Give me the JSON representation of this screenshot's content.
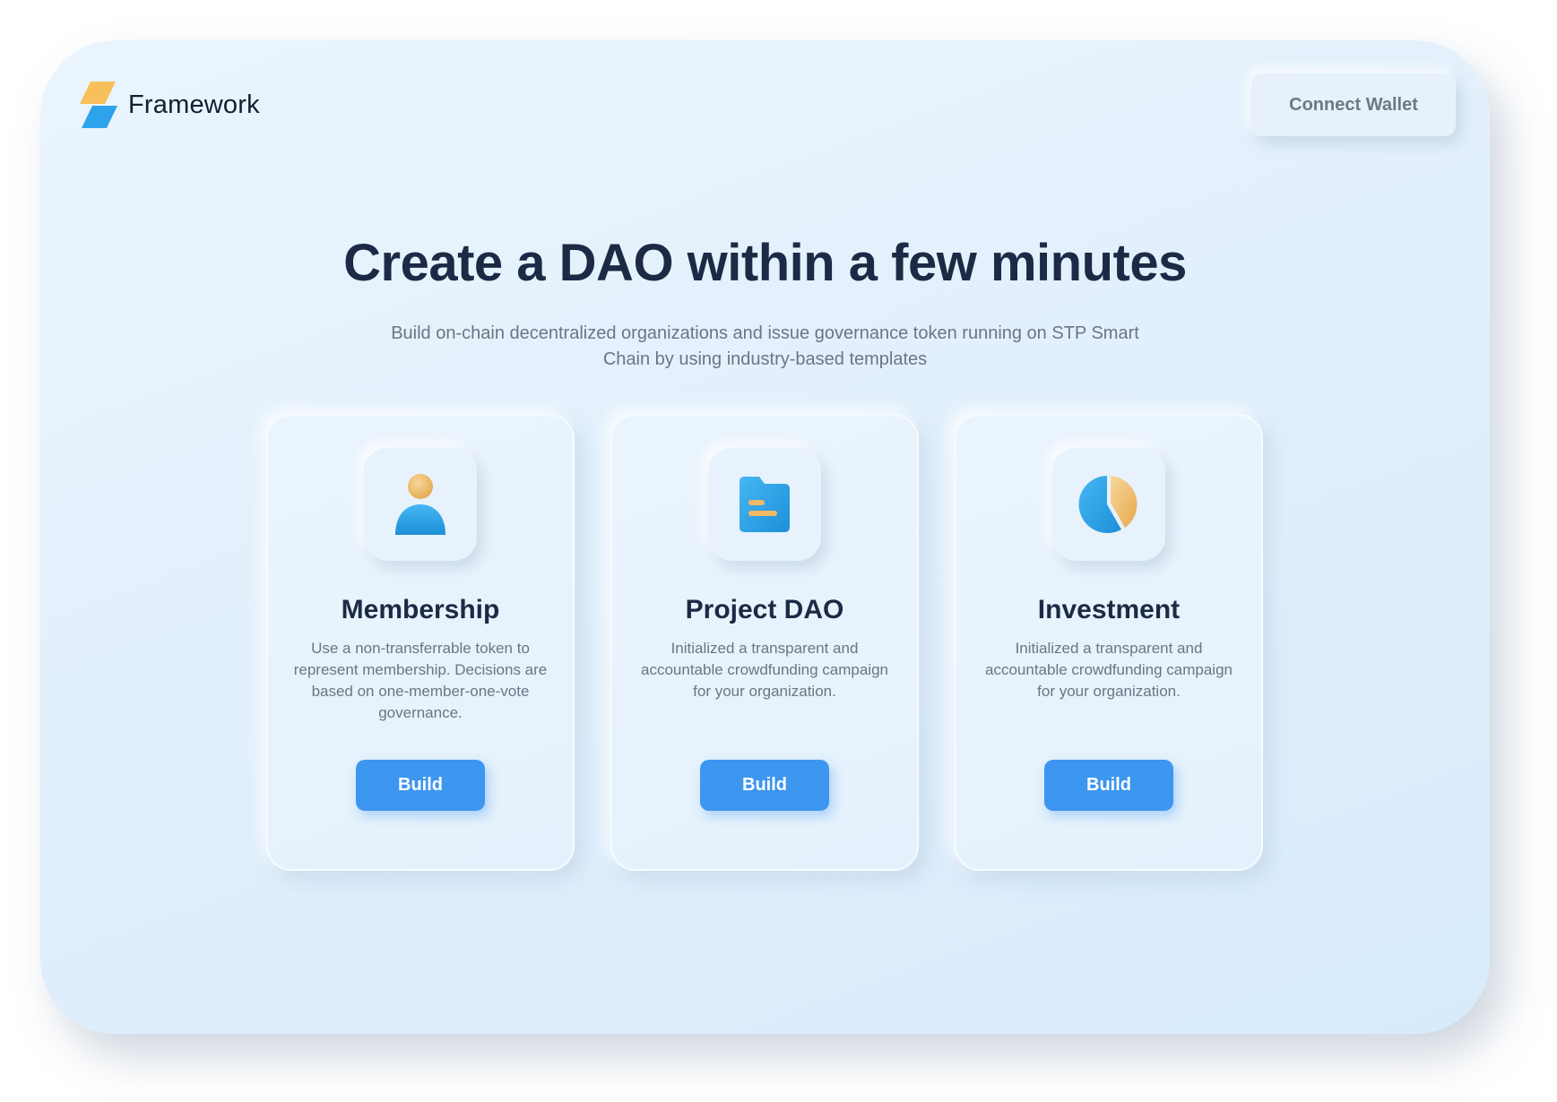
{
  "brand": {
    "name": "Framework",
    "logo_icon": "lightning-bolt-icon",
    "colors": {
      "top": "#f8c05a",
      "bottom": "#2ea3ec"
    }
  },
  "header": {
    "connect_label": "Connect Wallet"
  },
  "hero": {
    "title": "Create a DAO within a few minutes",
    "subtitle": "Build on-chain decentralized organizations and issue governance token running on STP Smart Chain by using industry-based templates"
  },
  "cards": [
    {
      "title": "Membership",
      "description": "Use a non-transferrable token to represent membership. Decisions are based on one-member-one-vote governance.",
      "icon": "user-icon",
      "button_label": "Build"
    },
    {
      "title": "Project DAO",
      "description": "Initialized a transparent and accountable crowdfunding campaign for your organization.",
      "icon": "folder-icon",
      "button_label": "Build"
    },
    {
      "title": "Investment",
      "description": "Initialized a transparent and accountable crowdfunding campaign for your organization.",
      "icon": "pie-chart-icon",
      "button_label": "Build"
    }
  ],
  "theme": {
    "accent": "#3d96f0",
    "heading": "#1c2a45",
    "muted": "#6b7584",
    "icon_blue": "#2ea3ec",
    "icon_gold": "#f1b866"
  }
}
